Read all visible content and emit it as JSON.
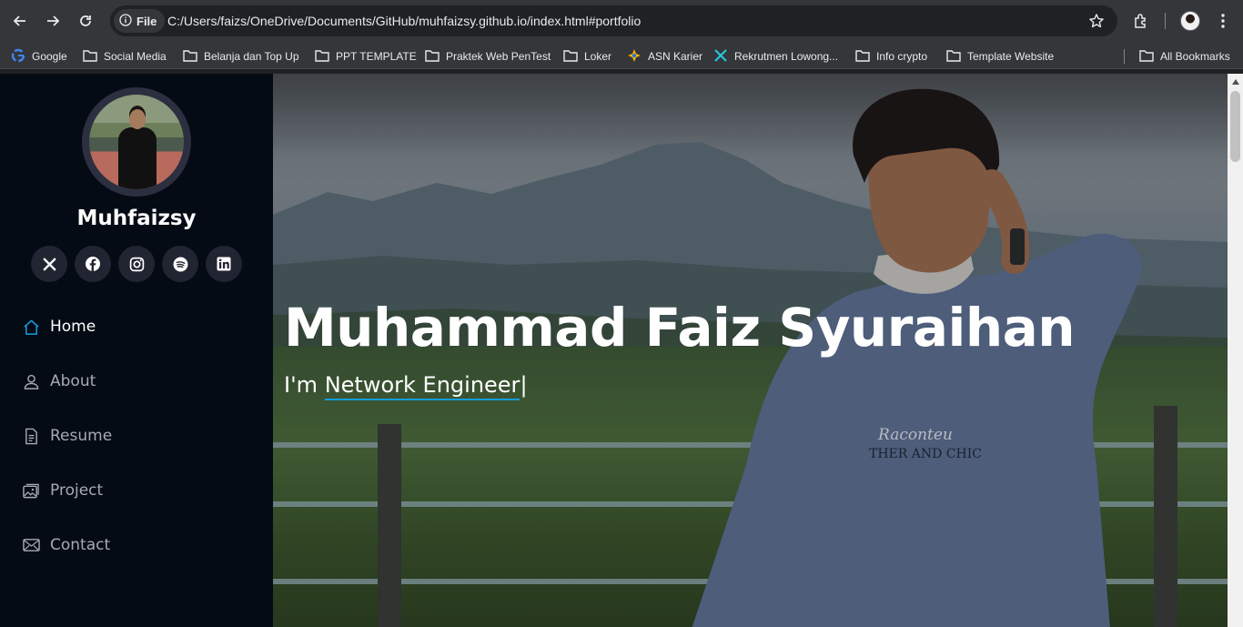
{
  "browser": {
    "site_chip_label": "File",
    "url": "C:/Users/faizs/OneDrive/Documents/GitHub/muhfaizsy.github.io/index.html#portfolio",
    "bookmarks": [
      {
        "label": "Google",
        "icon": "google-icon"
      },
      {
        "label": "Social Media",
        "icon": "folder-icon"
      },
      {
        "label": "Belanja dan Top Up",
        "icon": "folder-icon"
      },
      {
        "label": "PPT TEMPLATE",
        "icon": "folder-icon"
      },
      {
        "label": "Praktek Web PenTest",
        "icon": "folder-icon"
      },
      {
        "label": "Loker",
        "icon": "folder-icon"
      },
      {
        "label": "ASN Karier",
        "icon": "asn-icon"
      },
      {
        "label": "Rekrutmen Lowong...",
        "icon": "rekrutmen-icon"
      },
      {
        "label": "Info crypto",
        "icon": "folder-icon"
      },
      {
        "label": "Template Website",
        "icon": "folder-icon"
      }
    ],
    "all_bookmarks_label": "All Bookmarks"
  },
  "sidebar": {
    "brand": "Muhfaizsy",
    "socials": [
      "x-icon",
      "facebook-icon",
      "instagram-icon",
      "spotify-icon",
      "linkedin-icon"
    ],
    "menu": [
      {
        "label": "Home",
        "icon": "home-icon",
        "active": true
      },
      {
        "label": "About",
        "icon": "person-icon",
        "active": false
      },
      {
        "label": "Resume",
        "icon": "file-icon",
        "active": false
      },
      {
        "label": "Project",
        "icon": "images-icon",
        "active": false
      },
      {
        "label": "Contact",
        "icon": "envelope-icon",
        "active": false
      }
    ]
  },
  "hero": {
    "title": "Muhammad Faiz Syuraihan",
    "subtitle_prefix": "I'm",
    "typed_text": "Network Engineer",
    "cursor": "|",
    "shirt_text_1": "Raconteu",
    "shirt_text_2": "THER AND CHIC"
  },
  "colors": {
    "accent": "#149ddd",
    "sidebar_bg": "#040b14",
    "social_bg": "#212431"
  }
}
